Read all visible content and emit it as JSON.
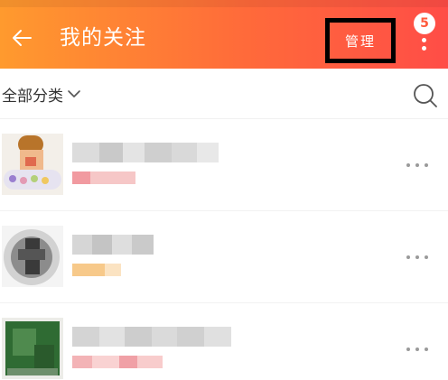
{
  "header": {
    "title": "我的关注",
    "manage_label": "管理",
    "badge_count": "5",
    "icons": [
      "arrow-left-icon",
      "more-vertical-icon"
    ]
  },
  "filter": {
    "category_label": "全部分类",
    "icons": [
      "chevron-down-icon",
      "search-icon"
    ]
  },
  "list": {
    "items": [
      {
        "name": "",
        "tag": "",
        "avatar": "store-avatar-1"
      },
      {
        "name": "",
        "tag": "",
        "avatar": "store-avatar-2"
      },
      {
        "name": "",
        "tag": "",
        "avatar": "store-avatar-3"
      }
    ],
    "row_more_icon": "more-horizontal-icon"
  },
  "colors": {
    "header_gradient_start": "#ff9a2e",
    "header_gradient_end": "#ff4d47",
    "highlight_border": "#000000",
    "text_primary": "#333333"
  }
}
